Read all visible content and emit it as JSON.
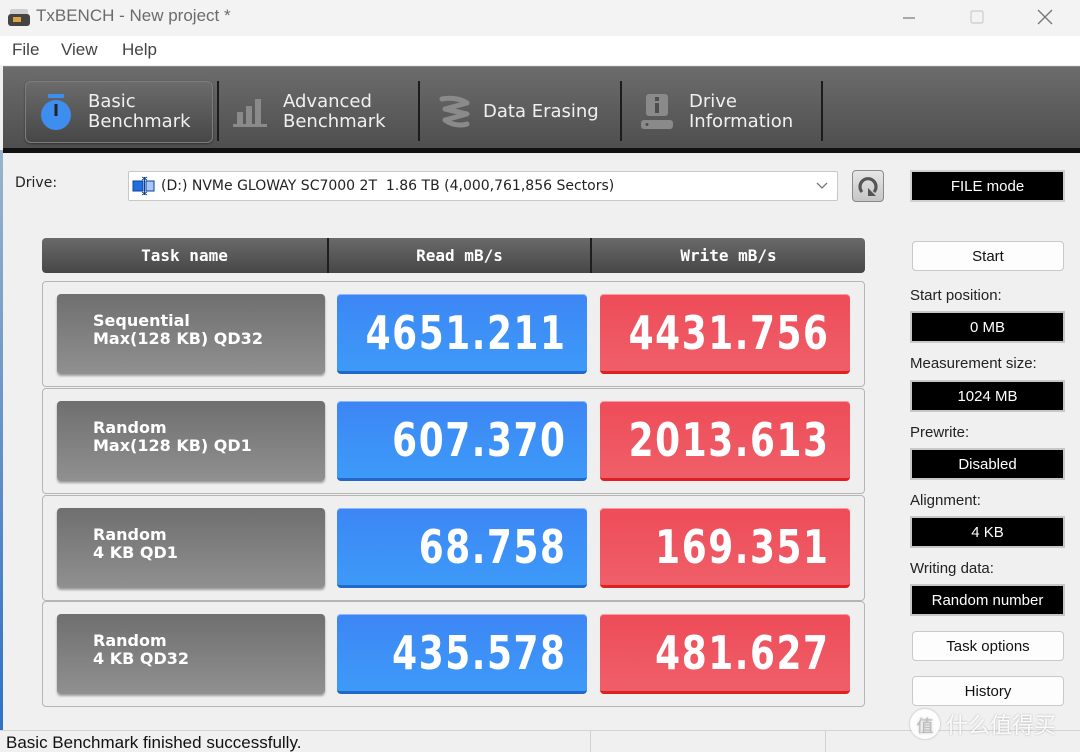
{
  "window": {
    "title": "TxBENCH - New project *",
    "controls": [
      "minimize",
      "maximize",
      "close"
    ]
  },
  "menu": {
    "items": [
      {
        "label": "File"
      },
      {
        "label": "View"
      },
      {
        "label": "Help"
      }
    ]
  },
  "toolbar": {
    "tabs": [
      {
        "line1": "Basic",
        "line2": "Benchmark",
        "icon": "stopwatch-icon",
        "active": true
      },
      {
        "line1": "Advanced",
        "line2": "Benchmark",
        "icon": "bar-chart-icon",
        "active": false
      },
      {
        "line1": "Data Erasing",
        "line2": "",
        "icon": "eraser-icon",
        "active": false
      },
      {
        "line1": "Drive",
        "line2": "Information",
        "icon": "drive-info-icon",
        "active": false
      }
    ]
  },
  "drive": {
    "label": "Drive:",
    "selected": "(D:) NVMe GLOWAY SC7000 2T  1.86 TB (4,000,761,856 Sectors)",
    "mode": "FILE mode"
  },
  "results": {
    "headers": {
      "task": "Task name",
      "read": "Read mB/s",
      "write": "Write mB/s"
    },
    "rows": [
      {
        "line1": "Sequential",
        "line2": "Max(128 KB) QD32",
        "read": "4651.211",
        "write": "4431.756"
      },
      {
        "line1": "Random",
        "line2": "Max(128 KB) QD1",
        "read": "607.370",
        "write": "2013.613"
      },
      {
        "line1": "Random",
        "line2": "4 KB QD1",
        "read": "68.758",
        "write": "169.351"
      },
      {
        "line1": "Random",
        "line2": "4 KB QD32",
        "read": "435.578",
        "write": "481.627"
      }
    ],
    "colors": {
      "read": "#3d8ff6",
      "write": "#ee5560"
    }
  },
  "side": {
    "start_label": "Start",
    "start_position_label": "Start position:",
    "start_position_value": "0 MB",
    "measurement_size_label": "Measurement size:",
    "measurement_size_value": "1024 MB",
    "prewrite_label": "Prewrite:",
    "prewrite_value": "Disabled",
    "alignment_label": "Alignment:",
    "alignment_value": "4 KB",
    "writing_data_label": "Writing data:",
    "writing_data_value": "Random number",
    "task_options_label": "Task options",
    "history_label": "History"
  },
  "status": {
    "text": "Basic Benchmark finished successfully."
  },
  "watermark": {
    "glyph": "值",
    "text": "什么值得买"
  }
}
